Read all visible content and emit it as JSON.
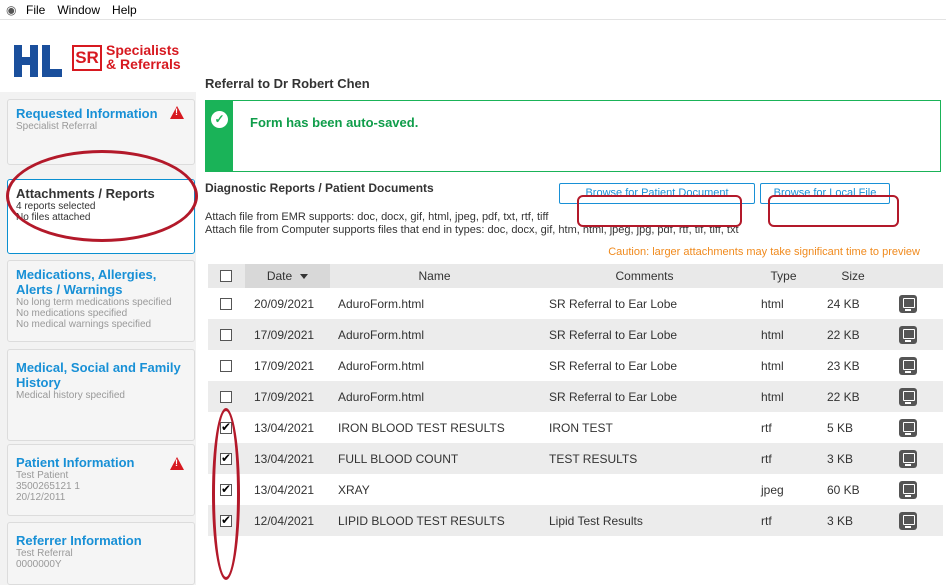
{
  "menubar": {
    "items": [
      "File",
      "Window",
      "Help"
    ]
  },
  "header": {
    "logo_sr_mark": "SR",
    "logo_sr_line1": "Specialists",
    "logo_sr_line2": "& Referrals",
    "title": "Referral to Dr Robert Chen"
  },
  "sidebar": {
    "requested": {
      "title": "Requested Information",
      "sub": "Specialist Referral"
    },
    "attachments": {
      "title": "Attachments / Reports",
      "sub1": "4 reports selected",
      "sub2": "No files attached"
    },
    "medications": {
      "title1": "Medications, Allergies,",
      "title2": "Alerts / Warnings",
      "sub1": "No long term medications specified",
      "sub2": "No medications specified",
      "sub3": "No medical warnings specified"
    },
    "history": {
      "title1": "Medical, Social and Family",
      "title2": "History",
      "sub": "Medical history specified"
    },
    "patient": {
      "title": "Patient Information",
      "sub1": "Test Patient",
      "sub2": "3500265121 1",
      "sub3": "20/12/2011"
    },
    "referrer": {
      "title": "Referrer Information",
      "sub1": "Test Referral",
      "sub2": "0000000Y"
    }
  },
  "autosave": {
    "message": "Form has been auto-saved."
  },
  "documents": {
    "section_title": "Diagnostic Reports / Patient Documents",
    "browse_patient": "Browse for Patient Document",
    "browse_local": "Browse for Local File",
    "emr_support": "Attach file from EMR supports: doc, docx, gif, html, jpeg, pdf, txt, rtf, tiff",
    "computer_support": "Attach file from Computer supports files that end in types: doc, docx, gif, htm, html, jpeg, jpg, pdf, rtf, tif, tiff, txt",
    "caution": "Caution: larger attachments may take significant time to preview"
  },
  "table": {
    "headers": {
      "date": "Date",
      "name": "Name",
      "comments": "Comments",
      "type": "Type",
      "size": "Size"
    },
    "rows": [
      {
        "checked": false,
        "date": "20/09/2021",
        "name": "AduroForm.html",
        "comments": "SR Referral to Ear Lobe",
        "type": "html",
        "size": "24 KB"
      },
      {
        "checked": false,
        "date": "17/09/2021",
        "name": "AduroForm.html",
        "comments": "SR Referral to Ear Lobe",
        "type": "html",
        "size": "22 KB"
      },
      {
        "checked": false,
        "date": "17/09/2021",
        "name": "AduroForm.html",
        "comments": "SR Referral to Ear Lobe",
        "type": "html",
        "size": "23 KB"
      },
      {
        "checked": false,
        "date": "17/09/2021",
        "name": "AduroForm.html",
        "comments": "SR Referral to Ear Lobe",
        "type": "html",
        "size": "22 KB"
      },
      {
        "checked": true,
        "date": "13/04/2021",
        "name": "IRON BLOOD TEST RESULTS",
        "comments": "IRON TEST",
        "type": "rtf",
        "size": "5 KB"
      },
      {
        "checked": true,
        "date": "13/04/2021",
        "name": "FULL BLOOD COUNT",
        "comments": "TEST RESULTS",
        "type": "rtf",
        "size": "3 KB"
      },
      {
        "checked": true,
        "date": "13/04/2021",
        "name": "XRAY",
        "comments": "",
        "type": "jpeg",
        "size": "60 KB"
      },
      {
        "checked": true,
        "date": "12/04/2021",
        "name": "LIPID BLOOD TEST RESULTS",
        "comments": "Lipid Test Results",
        "type": "rtf",
        "size": "3 KB"
      }
    ]
  },
  "colors": {
    "accent": "#1890d6",
    "success": "#1ab358",
    "alert": "#d71920",
    "annotation": "#b3192a",
    "caution": "#f08a1d"
  }
}
